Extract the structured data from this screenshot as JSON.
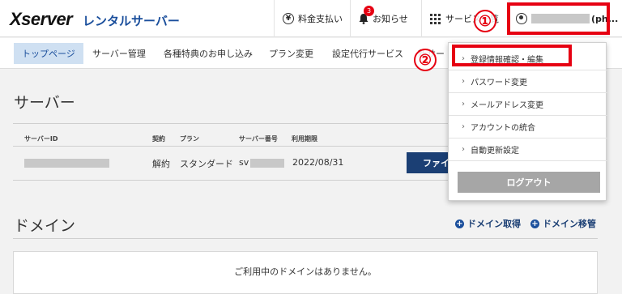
{
  "header": {
    "logo_main": "Xserver",
    "logo_sub": "レンタルサーバー",
    "billing_label": "料金支払い",
    "notice_label": "お知らせ",
    "notice_count": "3",
    "services_label": "サービス一覧",
    "user_suffix": "(ph..."
  },
  "nav": {
    "items": [
      "トップページ",
      "サーバー管理",
      "各種特典のお申し込み",
      "プラン変更",
      "設定代行サービス",
      "新サー"
    ]
  },
  "server": {
    "title": "サーバー",
    "columns": [
      "サーバーID",
      "契約",
      "プラン",
      "サーバー番号",
      "利用期限"
    ],
    "row": {
      "contract": "解約",
      "plan": "スタンダード",
      "server_no_prefix": "sv",
      "expiry": "2022/08/31",
      "file_button": "ファイ"
    }
  },
  "domain": {
    "title": "ドメイン",
    "acquire_label": "ドメイン取得",
    "transfer_label": "ドメイン移管",
    "empty_message": "ご利用中のドメインはありません。"
  },
  "dropdown": {
    "items": [
      "登録情報確認・編集",
      "パスワード変更",
      "メールアドレス変更",
      "アカウントの統合",
      "自動更新設定"
    ],
    "logout_label": "ログアウト"
  },
  "annotations": {
    "step1": "①",
    "step2": "②",
    "accent_color": "#e60012"
  }
}
